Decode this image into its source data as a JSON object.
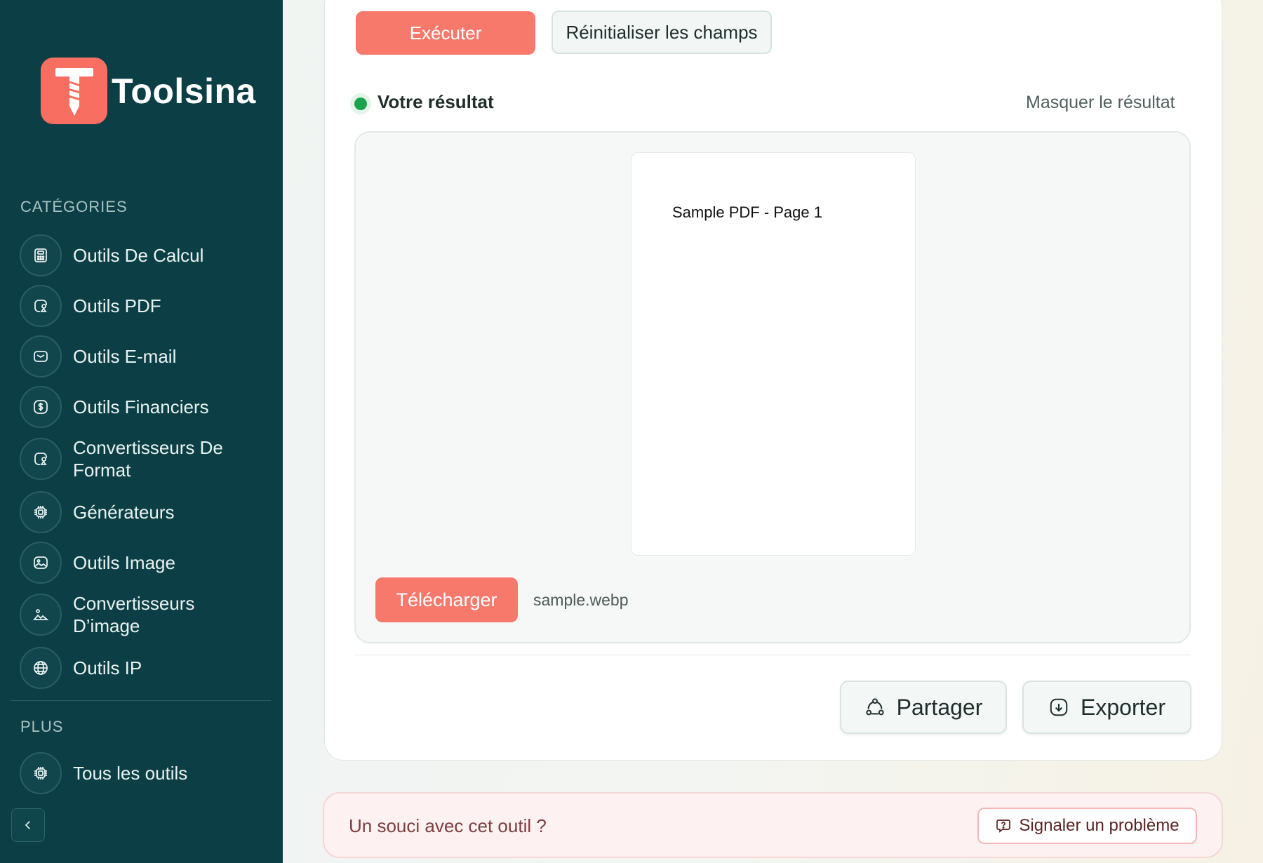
{
  "brand": {
    "name": "Toolsina",
    "accent": "#f86f61",
    "sidebar_bg": "#0c3f45"
  },
  "sidebar": {
    "categories_title": "CATÉGORIES",
    "items": [
      {
        "label": "Outils De Calcul",
        "icon": "calculator-icon"
      },
      {
        "label": "Outils PDF",
        "icon": "pdf-shapes-icon"
      },
      {
        "label": "Outils E-mail",
        "icon": "mail-icon"
      },
      {
        "label": "Outils Financiers",
        "icon": "dollar-icon"
      },
      {
        "label": "Convertisseurs De Format",
        "icon": "format-shapes-icon"
      },
      {
        "label": "Générateurs",
        "icon": "chip-icon"
      },
      {
        "label": "Outils Image",
        "icon": "image-icon"
      },
      {
        "label": "Convertisseurs D’image",
        "icon": "image-convert-icon"
      },
      {
        "label": "Outils IP",
        "icon": "globe-icon"
      }
    ],
    "more_title": "PLUS",
    "more_items": [
      {
        "label": "Tous les outils",
        "icon": "chip-icon"
      }
    ]
  },
  "toolbar": {
    "run_label": "Exécuter",
    "reset_label": "Réinitialiser les champs"
  },
  "result": {
    "title": "Votre résultat",
    "hide_label": "Masquer le résultat",
    "preview_text": "Sample PDF - Page 1",
    "download_label": "Télécharger",
    "file_name": "sample.webp",
    "status_color": "#1aa34a"
  },
  "actions": {
    "share_label": "Partager",
    "export_label": "Exporter"
  },
  "report": {
    "question": "Un souci avec cet outil ?",
    "button_label": "Signaler un problème"
  }
}
